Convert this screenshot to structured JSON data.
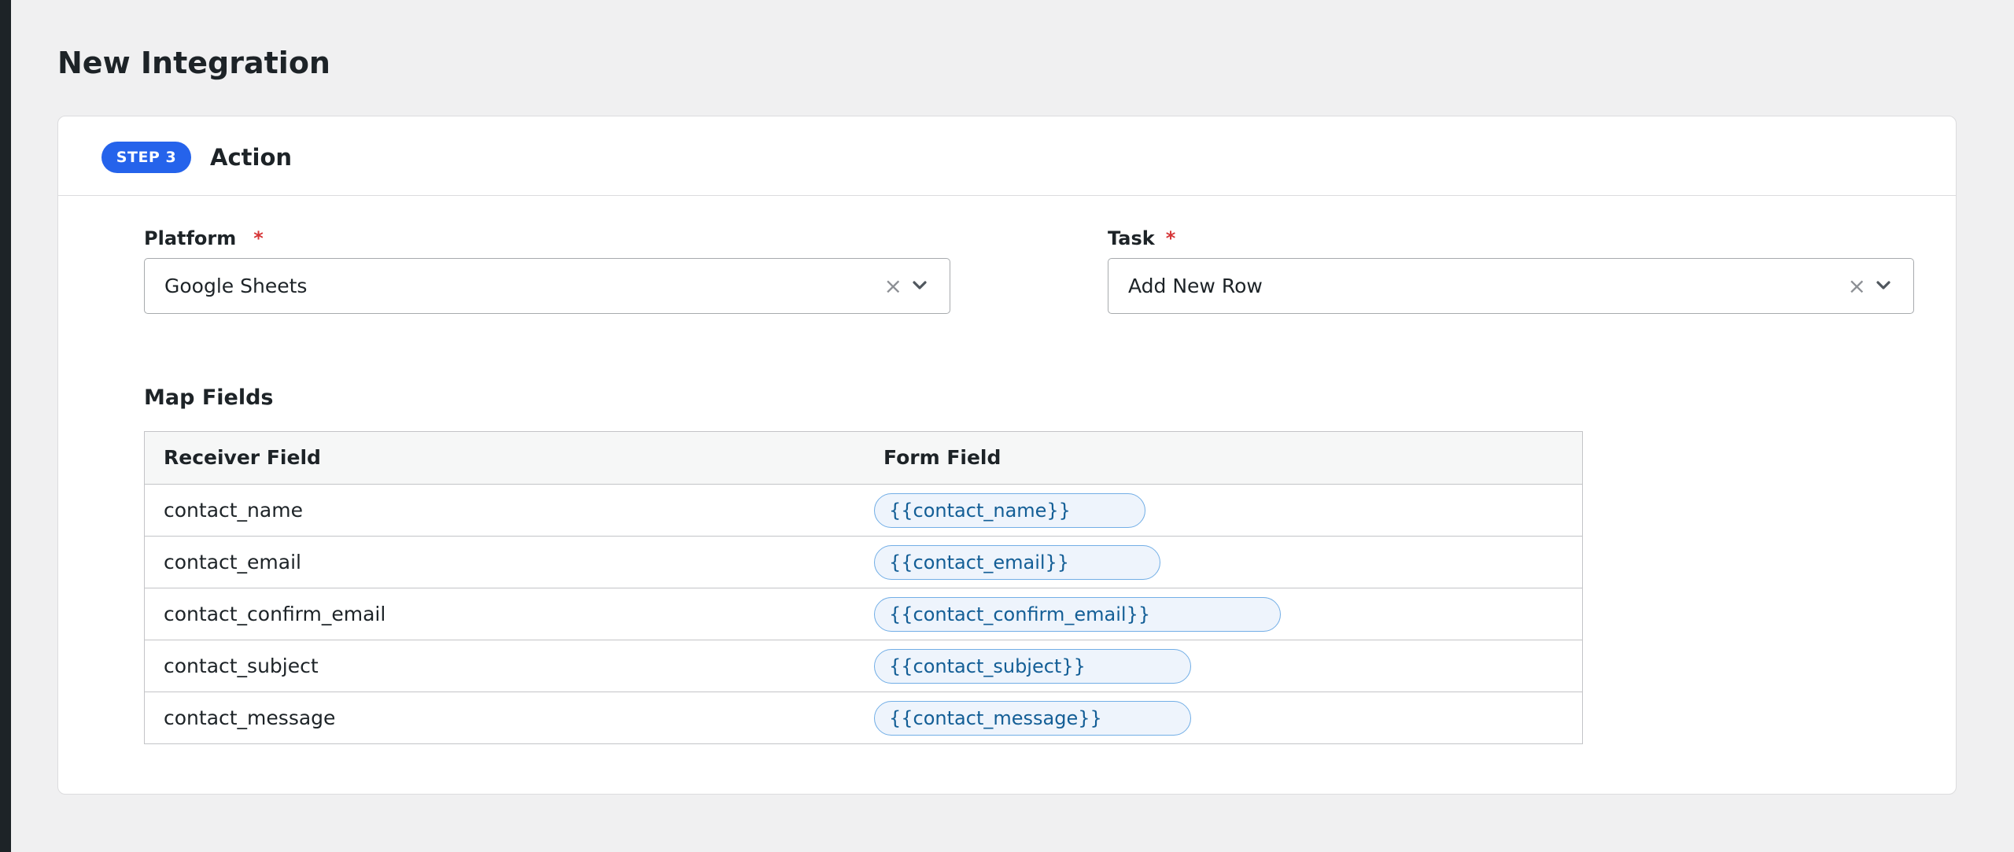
{
  "page": {
    "title": "New Integration"
  },
  "step": {
    "badge": "STEP 3",
    "title": "Action"
  },
  "fields": {
    "platform": {
      "label": "Platform",
      "required_mark": "*",
      "value": "Google Sheets",
      "clear_symbol": "×"
    },
    "task": {
      "label": "Task",
      "required_mark": "*",
      "value": "Add New Row",
      "clear_symbol": "×"
    }
  },
  "map_fields": {
    "title": "Map Fields",
    "headers": {
      "receiver": "Receiver Field",
      "form": "Form Field"
    },
    "rows": [
      {
        "receiver": "contact_name",
        "form": "{{contact_name}}"
      },
      {
        "receiver": "contact_email",
        "form": "{{contact_email}}"
      },
      {
        "receiver": "contact_confirm_email",
        "form": "{{contact_confirm_email}}"
      },
      {
        "receiver": "contact_subject",
        "form": "{{contact_subject}}"
      },
      {
        "receiver": "contact_message",
        "form": "{{contact_message}}"
      }
    ]
  },
  "colors": {
    "accent": "#2563eb",
    "required": "#d63638",
    "tag_text": "#135e96",
    "tag_border": "#72aee6",
    "tag_background": "#eef4fc"
  },
  "icons": {
    "clear": "close-icon",
    "dropdown": "chevron-down-icon"
  }
}
